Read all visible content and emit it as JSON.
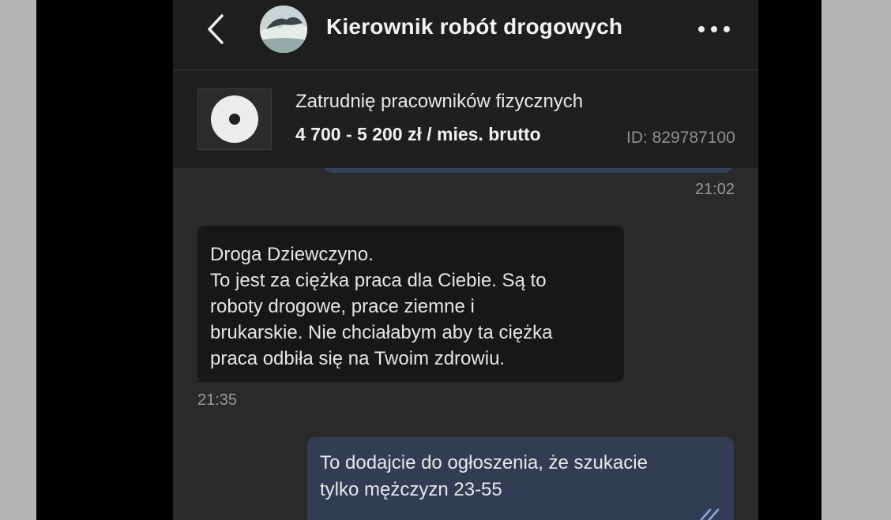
{
  "header": {
    "title": "Kierownik robót drogowych",
    "back_icon": "chevron-left-icon",
    "more_icon": "more-horizontal-icon"
  },
  "listing": {
    "title": "Zatrudnię pracowników fizycznych",
    "salary": "4 700 - 5 200 zł / mies. brutto",
    "id": "ID: 829787100"
  },
  "messages": [
    {
      "direction": "outgoing",
      "time": "21:02"
    },
    {
      "direction": "incoming",
      "lines": [
        "Droga Dziewczyno.",
        "To jest za ciężka praca dla Ciebie. Są to",
        "roboty drogowe, prace ziemne i",
        "brukarskie. Nie chciałabym aby ta ciężka",
        "praca odbiła się na Twoim zdrowiu."
      ],
      "time": "21:35"
    },
    {
      "direction": "outgoing",
      "lines": [
        "To dodajcie do ogłoszenia, że szukacie",
        "tylko mężczyzn 23-55"
      ]
    }
  ],
  "colors": {
    "background": "#2a2a2a",
    "header": "#1e1e1e",
    "incoming_bubble": "#171717",
    "outgoing_bubble": "#323d55"
  }
}
